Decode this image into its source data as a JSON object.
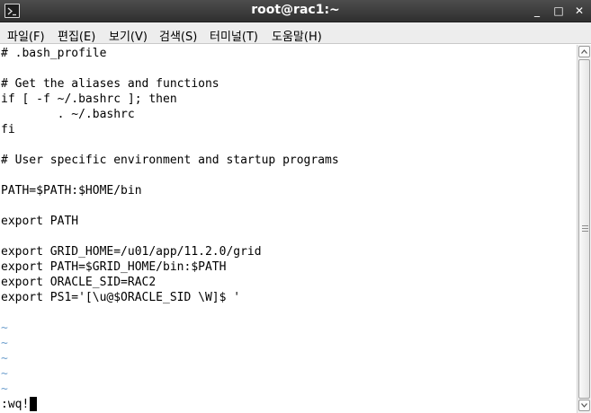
{
  "window": {
    "title": "root@rac1:~",
    "controls": {
      "minimize": "_",
      "maximize": "□",
      "close": "✕"
    },
    "icon": "terminal-icon"
  },
  "menu": [
    {
      "label": "파일(F)"
    },
    {
      "label": "편집(E)"
    },
    {
      "label": "보기(V)"
    },
    {
      "label": "검색(S)"
    },
    {
      "label": "터미널(T)"
    },
    {
      "label": "도움말(H)"
    }
  ],
  "terminal": {
    "lines": [
      "# .bash_profile",
      "",
      "# Get the aliases and functions",
      "if [ -f ~/.bashrc ]; then",
      "        . ~/.bashrc",
      "fi",
      "",
      "# User specific environment and startup programs",
      "",
      "PATH=$PATH:$HOME/bin",
      "",
      "export PATH",
      "",
      "export GRID_HOME=/u01/app/11.2.0/grid",
      "export PATH=$GRID_HOME/bin:$PATH",
      "export ORACLE_SID=RAC2",
      "export PS1='[\\u@$ORACLE_SID \\W]$ '",
      "",
      "~",
      "~",
      "~",
      "~",
      "~"
    ],
    "command_line": ":wq!"
  },
  "colors": {
    "titlebar": "#3a3a3a",
    "menubar": "#ededed",
    "text": "#000000",
    "tilde": "#6fa0ce"
  }
}
